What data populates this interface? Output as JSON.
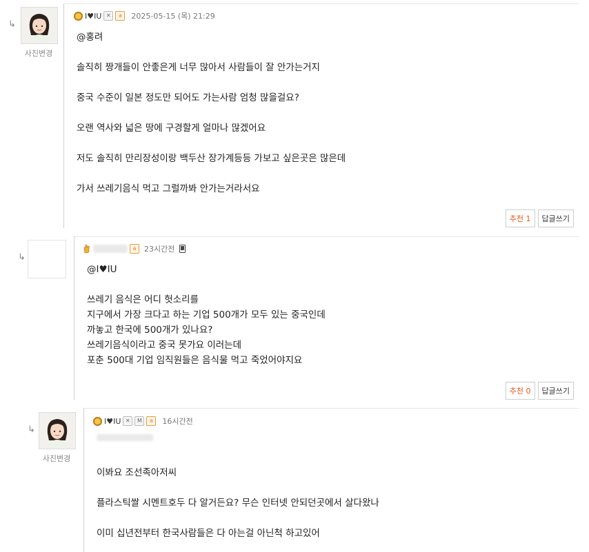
{
  "comments": [
    {
      "nick": "I♥IU",
      "date": "2025-05-15 (목) 21:29",
      "photo_label": "사진변경",
      "mention": "@홍려",
      "lines": [
        "솔직히 짱개들이 안좋은게 너무 많아서 사람들이 잘 안가는거지",
        "중국 수준이 일본 정도만 되어도 가는사람 엄청 많을걸요?",
        "오랜 역사와 넓은 땅에 구경할게 얼마나 많겠어요",
        "저도 솔직히 만리장성이랑 백두산 장가계등등 가보고 싶은곳은 많은데",
        "가서 쓰레기음식 먹고 그럴까봐 안가는거라서요"
      ],
      "recommend": "추천 1",
      "reply": "답글쓰기"
    },
    {
      "date": "23시간전",
      "mention": "@I♥IU",
      "lines": [
        "쓰레기 음식은  어디 헛소리를",
        "지구에서 가장 크다고 하는 기업 500개가 모두 있는 중국인데",
        "까놓고  한국에 500개가 있나요?",
        "쓰레기음식이라고 중국 못가요 이러는데",
        "포춘 500대 기업 임직원들은  음식물 먹고 죽었어야지요"
      ],
      "recommend": "추천 0",
      "reply": "답글쓰기"
    },
    {
      "nick": "I♥IU",
      "date": "16시간전",
      "photo_label": "사진변경",
      "lines": [
        "이봐요 조선족아저씨",
        "플라스틱쌀 시멘트호두 다 알거든요? 무슨 인터넷 안되던곳에서 살다왔나",
        "이미 십년전부터 한국사람들은 다 아는걸 아닌척 하고있어"
      ]
    }
  ],
  "arrow_glyph": "↳",
  "icons": {
    "medal": "medal-icon",
    "badge_x": "✕",
    "badge_a": "a",
    "badge_m": "M",
    "phone": "phone-icon"
  }
}
